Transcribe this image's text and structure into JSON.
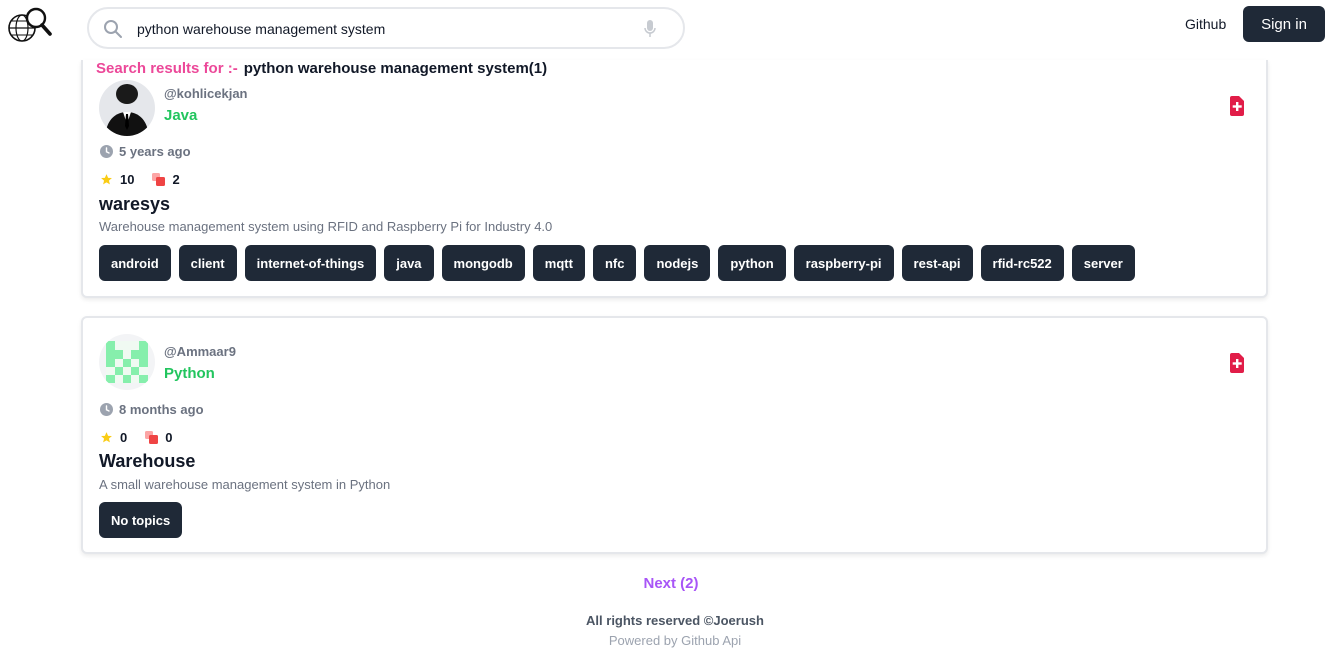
{
  "header": {
    "search_value": "python warehouse management system",
    "github_label": "Github",
    "signin_label": "Sign in"
  },
  "results": {
    "label": "Search results for :-",
    "query": "python warehouse management system(1)"
  },
  "repos": [
    {
      "username": "@kohlicekjan",
      "language": "Java",
      "time": "5 years ago",
      "stars": "10",
      "forks": "2",
      "name": "waresys",
      "description": "Warehouse management system using RFID and Raspberry Pi for Industry 4.0",
      "topics": [
        "android",
        "client",
        "internet-of-things",
        "java",
        "mongodb",
        "mqtt",
        "nfc",
        "nodejs",
        "python",
        "raspberry-pi",
        "rest-api",
        "rfid-rc522",
        "server"
      ]
    },
    {
      "username": "@Ammaar9",
      "language": "Python",
      "time": "8 months ago",
      "stars": "0",
      "forks": "0",
      "name": "Warehouse",
      "description": "A small warehouse management system in Python",
      "topics": [
        "No topics"
      ]
    }
  ],
  "pagination": {
    "next_label": "Next (2)"
  },
  "footer": {
    "rights": "All rights reserved ©Joerush",
    "powered": "Powered by Github Api"
  },
  "colors": {
    "accent_pink": "#ec4899",
    "language_green": "#22c55e",
    "next_purple": "#a855f7",
    "dark": "#1f2937",
    "bookmark_red": "#e11d48",
    "star_yellow": "#facc15",
    "fork_red": "#f87171"
  },
  "icons": [
    "globe-search-icon",
    "search-icon",
    "microphone-icon",
    "clock-icon",
    "star-icon",
    "fork-icon",
    "bookmark-add-icon"
  ]
}
